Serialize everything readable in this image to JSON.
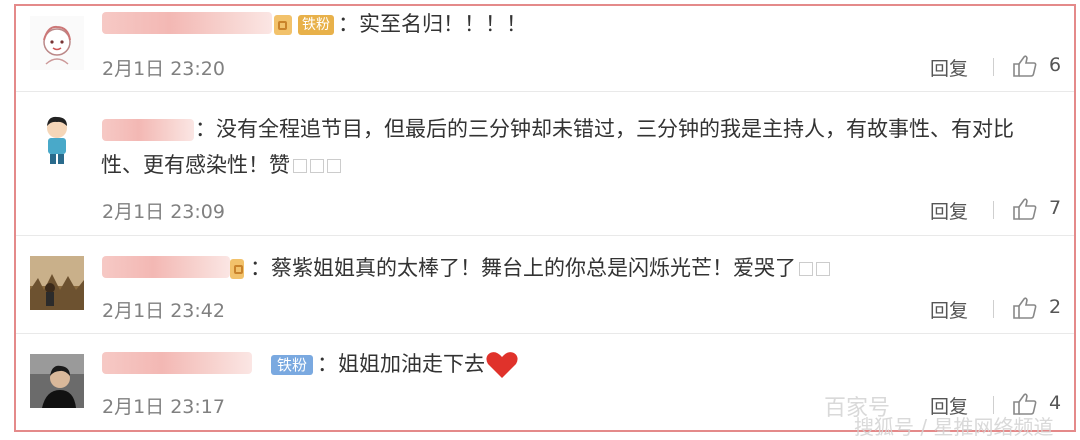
{
  "comments": [
    {
      "badge": "铁粉",
      "text": "：实至名归！！！！",
      "time": "2月1日 23:20",
      "reply": "回复",
      "likes": "6"
    },
    {
      "text": "：没有全程追节目，但最后的三分钟却未错过，三分钟的我是主持人，有故事性、有对比性、更有感染性！赞",
      "time": "2月1日 23:09",
      "reply": "回复",
      "likes": "7"
    },
    {
      "text": "：蔡紫姐姐真的太棒了！舞台上的你总是闪烁光芒！爱哭了",
      "time": "2月1日 23:42",
      "reply": "回复",
      "likes": "2"
    },
    {
      "badge": "铁粉",
      "text": "：姐姐加油走下去",
      "time": "2月1日 23:17",
      "reply": "回复",
      "likes": "4"
    }
  ],
  "icons": {
    "like": "thumbs-up-icon",
    "heart": "red-heart-emoji",
    "emoji_placeholder": "missing-emoji-box"
  },
  "colors": {
    "border": "#e48a8a",
    "heart": "#e0322b",
    "badge_blue": "#7aa9e0",
    "badge_gold": "#e8b14a"
  },
  "watermark": {
    "line1": "百家号",
    "line2": "搜狐号 / 星推网络频道"
  }
}
